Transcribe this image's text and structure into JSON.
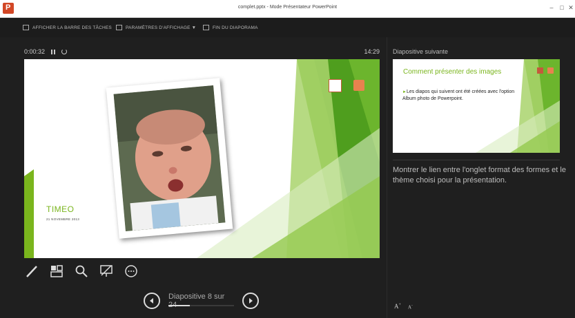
{
  "window": {
    "title": "complet.pptx - Mode Présentateur PowerPoint"
  },
  "toolbar": {
    "taskbar_label": "AFFICHER LA BARRE DES TÂCHES",
    "display_settings_label": "PARAMÈTRES D'AFFICHAGE ▼",
    "end_show_label": "FIN DU DIAPORAMA"
  },
  "presenter": {
    "elapsed": "0:00:32",
    "clock": "14:29"
  },
  "current_slide": {
    "title": "TIMEO",
    "date": "21 NOVEMBRE 2013"
  },
  "navigation": {
    "counter": "Diapositive 8 sur 24",
    "progress_fraction": 0.33
  },
  "next_slide": {
    "label": "Diapositive suivante",
    "title": "Comment présenter des images",
    "bullet": "Les diapos qui suivent ont été créées avec l'option Album photo de Powerpoint."
  },
  "notes": {
    "text": "Montrer le lien entre l'onglet format des formes et le thème choisi pour la présentation."
  },
  "colors": {
    "accent_green": "#7ab51d",
    "background": "#1f1f1f",
    "powerpoint_red": "#d24726"
  }
}
